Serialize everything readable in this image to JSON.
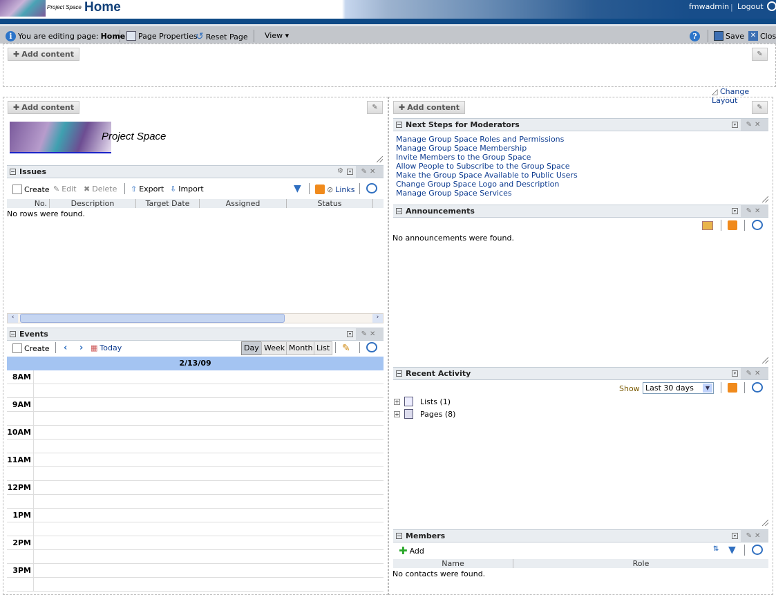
{
  "header": {
    "brand_small": "Project Space",
    "title": "Home",
    "user": "fmwadmin",
    "separator": "|",
    "logout": "Logout"
  },
  "edit_toolbar": {
    "editing_prefix": "You are editing page:",
    "editing_page": "Home",
    "page_properties": "Page Properties",
    "reset_page": "Reset Page",
    "view": "View ▾",
    "help": "?",
    "save": "Save",
    "close": "Close"
  },
  "layout": {
    "add_content": "Add content",
    "change_layout": "Change Layout",
    "pencil": "✎"
  },
  "banner": {
    "text": "Project Space"
  },
  "issues": {
    "title": "Issues",
    "toolbar": {
      "create": "Create",
      "edit": "Edit",
      "delete": "Delete",
      "export": "Export",
      "import": "Import",
      "links": "Links"
    },
    "columns": [
      "No.",
      "Description",
      "Target Date",
      "Assigned",
      "Status"
    ],
    "empty": "No rows were found."
  },
  "events": {
    "title": "Events",
    "toolbar": {
      "create": "Create",
      "today": "Today",
      "views": [
        "Day",
        "Week",
        "Month",
        "List"
      ],
      "active_view": "Day"
    },
    "date": "2/13/09",
    "hours": [
      "8AM",
      "9AM",
      "10AM",
      "11AM",
      "12PM",
      "1PM",
      "2PM",
      "3PM"
    ]
  },
  "next_steps": {
    "title": "Next Steps for Moderators",
    "links": [
      "Manage Group Space Roles and Permissions",
      "Manage Group Space Membership",
      "Invite Members to the Group Space",
      "Allow People to Subscribe to the Group Space",
      "Make the Group Space Available to Public Users",
      "Change Group Space Logo and Description",
      "Manage Group Space Services"
    ]
  },
  "announcements": {
    "title": "Announcements",
    "empty": "No announcements were found."
  },
  "recent_activity": {
    "title": "Recent Activity",
    "show_label": "Show",
    "show_value": "Last 30 days",
    "items": [
      {
        "label": "Lists (1)"
      },
      {
        "label": "Pages (8)"
      }
    ]
  },
  "members": {
    "title": "Members",
    "add": "Add",
    "columns": [
      "Name",
      "Role"
    ],
    "empty": "No contacts were found."
  }
}
